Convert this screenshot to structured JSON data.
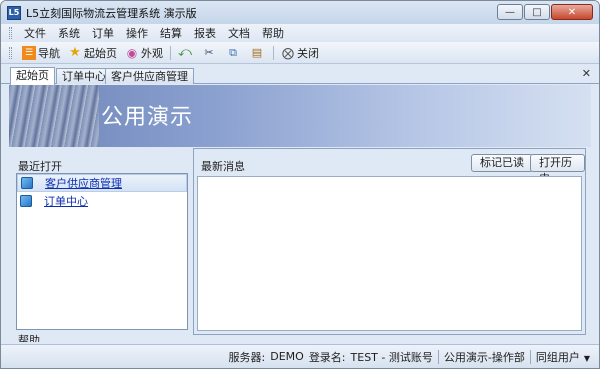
{
  "window": {
    "title": "L5立刻国际物流云管理系统 演示版",
    "app_icon": "L5",
    "controls": [
      "minimize-icon",
      "maximize-icon",
      "close-icon"
    ]
  },
  "menu": [
    "文件",
    "系统",
    "订单",
    "操作",
    "结算",
    "报表",
    "文档",
    "帮助"
  ],
  "toolbar": {
    "nav_label": "导航",
    "home_label": "起始页",
    "skin_label": "外观",
    "close_label": "关闭",
    "icons": [
      "back-icon",
      "cut-icon",
      "copy-icon",
      "paste-icon"
    ]
  },
  "tabs": [
    "起始页",
    "订单中心",
    "客户供应商管理"
  ],
  "banner": {
    "title": "公用演示"
  },
  "recent": {
    "label": "最近打开",
    "items": [
      "客户供应商管理",
      "订单中心"
    ]
  },
  "help_label": "帮助",
  "news": {
    "label": "最新消息",
    "mark_read": "标记已读",
    "open_history": "打开历史"
  },
  "status": {
    "server_label": "服务器:",
    "server_value": "DEMO",
    "login_label": "登录名:",
    "login_value": "TEST - 测试账号",
    "dept": "公用演示-操作部",
    "group": "同组用户"
  }
}
